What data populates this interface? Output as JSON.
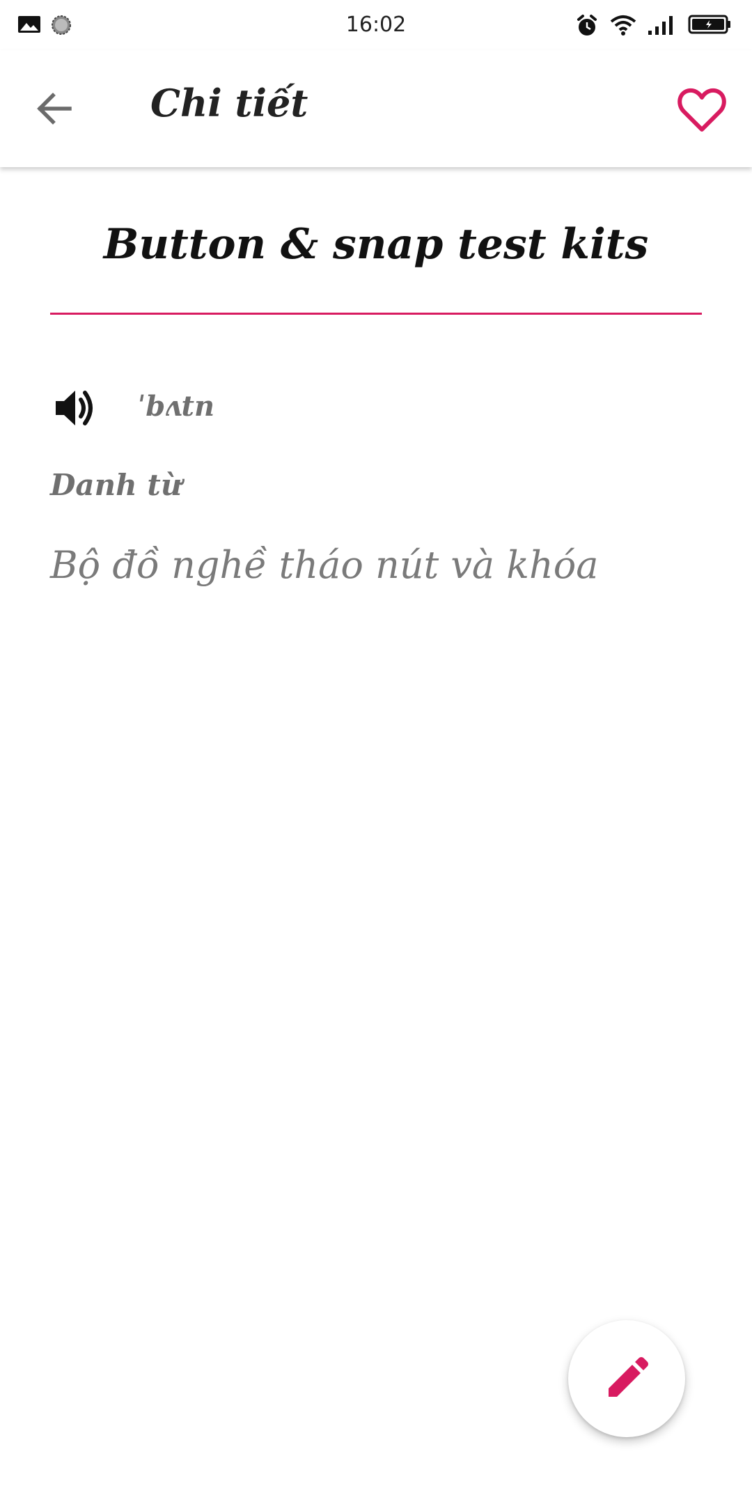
{
  "status_bar": {
    "time": "16:02",
    "icons": [
      "image-icon",
      "sync-icon",
      "alarm-icon",
      "wifi-icon",
      "signal-icon",
      "battery-icon"
    ]
  },
  "app_bar": {
    "title": "Chi tiết",
    "back_icon": "arrow-back-icon",
    "favorite_icon": "heart-outline-icon"
  },
  "word": {
    "title": "Button & snap test kits",
    "phonetic": "ˈbʌtn",
    "type": "Danh từ",
    "meaning": "Bộ đồ nghề tháo nút và khóa"
  },
  "fab": {
    "icon": "pencil-icon"
  },
  "colors": {
    "accent": "#d81b60",
    "text_dark": "#222222",
    "text_gray": "#6f6f6f"
  }
}
